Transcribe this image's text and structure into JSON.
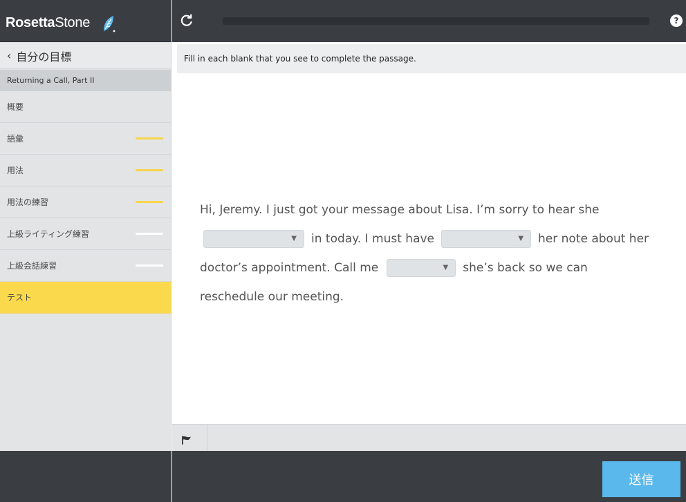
{
  "brand": {
    "word1": "Rosetta",
    "word2": "Stone"
  },
  "sidebar": {
    "back_label": "自分の目標",
    "unit_title": "Returning a Call, Part II",
    "items": [
      {
        "label": "概要",
        "indicator_color": null,
        "active": false
      },
      {
        "label": "語彙",
        "indicator_color": "#f7d54a",
        "active": false
      },
      {
        "label": "用法",
        "indicator_color": "#f7d54a",
        "active": false
      },
      {
        "label": "用法の練習",
        "indicator_color": "#f7d54a",
        "active": false
      },
      {
        "label": "上級ライティング練習",
        "indicator_color": "#ffffff",
        "active": false
      },
      {
        "label": "上級会話練習",
        "indicator_color": "#ffffff",
        "active": false
      },
      {
        "label": "テスト",
        "indicator_color": null,
        "active": true
      }
    ]
  },
  "topbar": {
    "refresh_icon": "refresh-icon",
    "help_icon": "help-icon",
    "help_glyph": "?",
    "progress_fraction": 0.0
  },
  "instructions": "Fill in each blank that you see to complete the passage.",
  "passage": {
    "line1": "Hi, Jeremy. I just got your message about Lisa. I’m sorry to hear she",
    "line2_a": "in today. I must have",
    "line2_b": "her note about her",
    "line3_a": "doctor’s appointment. Call me",
    "line3_b": "she’s back so we can",
    "line4": "reschedule our meeting.",
    "blanks": [
      {
        "value": ""
      },
      {
        "value": ""
      },
      {
        "value": ""
      }
    ]
  },
  "flag_icon": "flag-icon",
  "submit_label": "送信",
  "colors": {
    "accent_yellow": "#fbd94c",
    "submit_blue": "#5bb8ec",
    "dark_chrome": "#3a3e43"
  }
}
